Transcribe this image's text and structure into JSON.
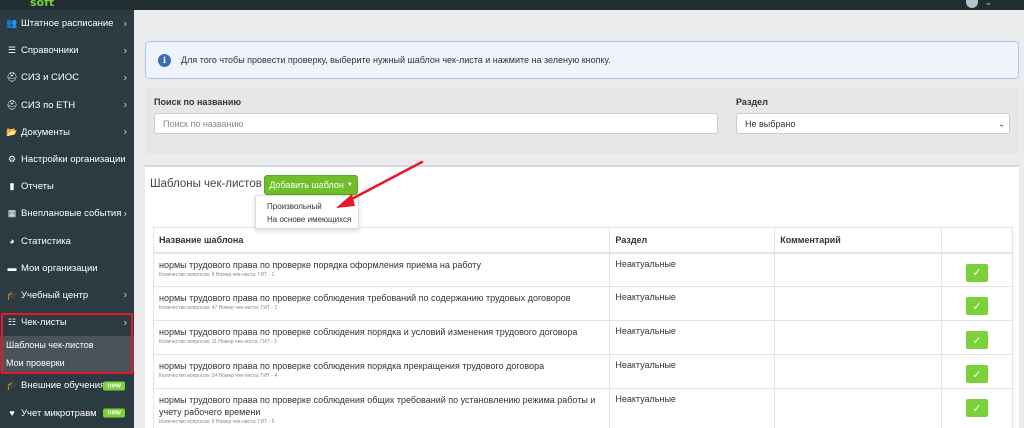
{
  "brand": "soft",
  "sidebar": {
    "items": [
      {
        "label": "Штатное расписание",
        "icon": "users-icon",
        "glyph": "👥",
        "chevron": true
      },
      {
        "label": "Справочники",
        "icon": "list-icon",
        "glyph": "☰",
        "chevron": true
      },
      {
        "label": "СИЗ и СИОС",
        "icon": "helmet-icon",
        "glyph": "⛑",
        "chevron": true
      },
      {
        "label": "СИЗ по ЕТН",
        "icon": "helmet-icon",
        "glyph": "⛑",
        "chevron": true
      },
      {
        "label": "Документы",
        "icon": "folder-open-icon",
        "glyph": "📂",
        "chevron": true
      },
      {
        "label": "Настройки организации",
        "icon": "gear-icon",
        "glyph": "⚙",
        "chevron": false
      },
      {
        "label": "Отчеты",
        "icon": "file-icon",
        "glyph": "▮",
        "chevron": false
      },
      {
        "label": "Внеплановые события",
        "icon": "calendar-icon",
        "glyph": "▦",
        "chevron": true
      },
      {
        "label": "Статистика",
        "icon": "pie-chart-icon",
        "glyph": "◕",
        "chevron": false
      },
      {
        "label": "Мои организации",
        "icon": "briefcase-icon",
        "glyph": "▬",
        "chevron": false
      },
      {
        "label": "Учебный центр",
        "icon": "graduation-cap-icon",
        "glyph": "🎓",
        "chevron": true
      },
      {
        "label": "Чек-листы",
        "icon": "checklist-icon",
        "glyph": "☷",
        "chevron": true
      }
    ],
    "submenu": [
      "Шаблоны чек-листов",
      "Мои проверки"
    ],
    "after": [
      {
        "label": "Внешние обучения",
        "icon": "graduation-cap-icon",
        "glyph": "🎓",
        "badge": "new"
      },
      {
        "label": "Учет микротравм",
        "icon": "heartbeat-icon",
        "glyph": "♥",
        "badge": "new"
      }
    ]
  },
  "alert": {
    "text": "Для того чтобы провести проверку, выберите нужный шаблон чек-листа и нажмите на зеленую кнопку."
  },
  "filters": {
    "search_label": "Поиск по названию",
    "search_placeholder": "Поиск по названию",
    "section_label": "Раздел",
    "section_value": "Не выбрано"
  },
  "templates": {
    "title": "Шаблоны чек-листов",
    "add_button": "Добавить шаблон",
    "dropdown": [
      "Произвольный",
      "На основе имеющихся"
    ],
    "columns": [
      "Название шаблона",
      "Раздел",
      "Комментарий",
      ""
    ],
    "rows": [
      {
        "name": "нормы трудового права по проверке порядка оформления приема на работу",
        "meta": "Количество вопросов: 9 Номер чек-листа: ГИТ - 1",
        "section": "Неактуальные",
        "comment": ""
      },
      {
        "name": "нормы трудового права по проверке соблюдения требований по содержанию трудовых договоров",
        "meta": "Количество вопросов: 47 Номер чек-листа: ГИТ - 2",
        "section": "Неактуальные",
        "comment": ""
      },
      {
        "name": "нормы трудового права по проверке соблюдения порядка и условий изменения трудового договора",
        "meta": "Количество вопросов: 11 Номер чек-листа: ГИТ - 3",
        "section": "Неактуальные",
        "comment": ""
      },
      {
        "name": "нормы трудового права по проверке соблюдения порядка прекращения трудового договора",
        "meta": "Количество вопросов: 24 Номер чек-листа: ГИТ - 4",
        "section": "Неактуальные",
        "comment": ""
      },
      {
        "name": "нормы трудового права по проверке соблюдения общих требований по установлению режима работы и учету рабочего времени",
        "meta": "Количество вопросов: 9 Номер чек-листа: ГИТ - 5",
        "section": "Неактуальные",
        "comment": ""
      }
    ]
  },
  "colors": {
    "sidebar": "#2c3b41",
    "accent_green": "#7ad13a",
    "highlight_red": "#e8182c",
    "info_blue": "#3d6fb6"
  }
}
